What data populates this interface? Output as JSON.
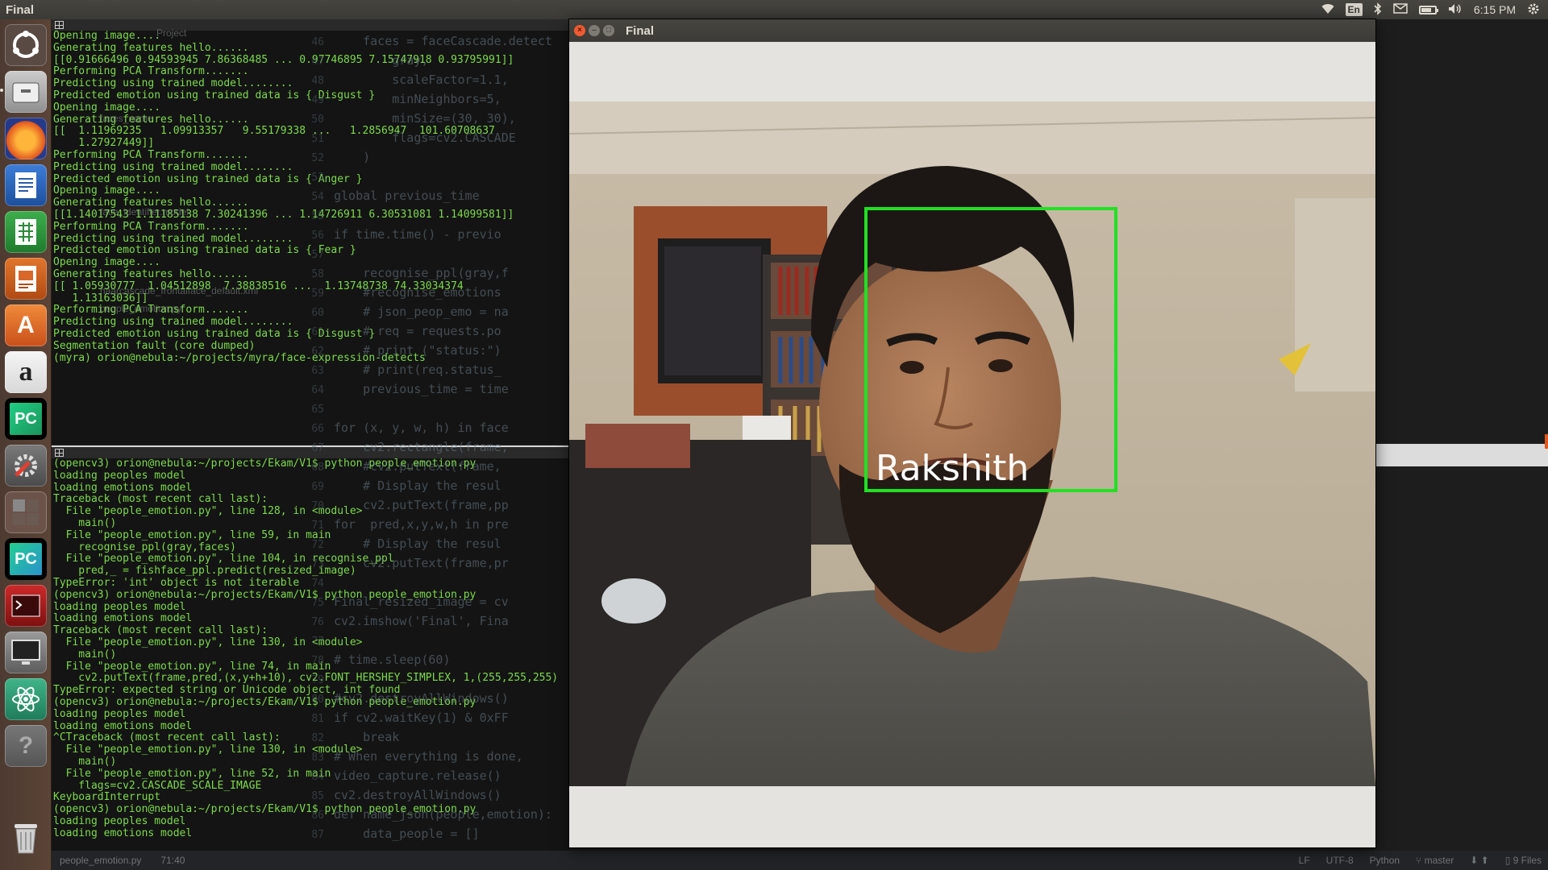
{
  "topbar": {
    "app_name": "Final",
    "input_lang": "En",
    "time": "6:15 PM"
  },
  "launcher": {
    "items": [
      {
        "name": "dash-home-icon"
      },
      {
        "name": "files-icon"
      },
      {
        "name": "firefox-icon"
      },
      {
        "name": "libreoffice-writer-icon"
      },
      {
        "name": "libreoffice-calc-icon"
      },
      {
        "name": "libreoffice-impress-icon"
      },
      {
        "name": "software-center-icon",
        "glyph": "A"
      },
      {
        "name": "amazon-icon",
        "glyph": "a"
      },
      {
        "name": "pycharm-icon",
        "glyph": "PC"
      },
      {
        "name": "system-settings-icon"
      },
      {
        "name": "workspace-switcher-icon"
      },
      {
        "name": "pycharm-icon-2",
        "glyph": "PC"
      },
      {
        "name": "terminal-red-icon"
      },
      {
        "name": "monitor-icon"
      },
      {
        "name": "atom-icon"
      },
      {
        "name": "help-icon",
        "glyph": "?"
      },
      {
        "name": "trash-icon"
      }
    ]
  },
  "terminal_top": {
    "lines": [
      "Opening image....",
      "Generating features hello......",
      "[[0.91666496 0.94593945 7.86368485 ... 0.97746895 7.15747918 0.93795991]]",
      "Performing PCA Transform.......",
      "Predicting using trained model........",
      "Predicted emotion using trained data is { Disgust }",
      "",
      "Opening image....",
      "Generating features hello......",
      "[[  1.11969235   1.09913357   9.55179338 ...   1.2856947  101.60708637",
      "    1.27927449]]",
      "Performing PCA Transform.......",
      "Predicting using trained model........",
      "Predicted emotion using trained data is { Anger }",
      "Opening image....",
      "Generating features hello......",
      "[[1.14017543 1.11185138 7.30241396 ... 1.14726911 6.30531081 1.14099581]]",
      "Performing PCA Transform.......",
      "Predicting using trained model........",
      "Predicted emotion using trained data is { Fear }",
      "",
      "Opening image....",
      "Generating features hello......",
      "[[ 1.05930777  1.04512898  7.38838516 ...  1.13748738 74.33034374",
      "   1.13163036]]",
      "Performing PCA Transform.......",
      "Predicting using trained model........",
      "Predicted emotion using trained data is { Disgust }",
      "",
      "Segmentation fault (core dumped)",
      "(myra) orion@nebula:~/projects/myra/face-expression-detects "
    ]
  },
  "terminal_bottom": {
    "lines": [
      "(opencv3) orion@nebula:~/projects/Ekam/V1$ python people_emotion.py",
      "loading peoples model",
      "loading emotions model",
      "Traceback (most recent call last):",
      "  File \"people_emotion.py\", line 128, in <module>",
      "    main()",
      "  File \"people_emotion.py\", line 59, in main",
      "    recognise_ppl(gray,faces)",
      "  File \"people_emotion.py\", line 104, in recognise_ppl",
      "    pred,_ = fishface_ppl.predict(resized_image)",
      "TypeError: 'int' object is not iterable",
      "(opencv3) orion@nebula:~/projects/Ekam/V1$ python people_emotion.py",
      "loading peoples model",
      "loading emotions model",
      "Traceback (most recent call last):",
      "  File \"people_emotion.py\", line 130, in <module>",
      "    main()",
      "  File \"people_emotion.py\", line 74, in main",
      "    cv2.putText(frame,pred,(x,y+h+10), cv2.FONT_HERSHEY_SIMPLEX, 1,(255,255,255)",
      "TypeError: expected string or Unicode object, int found",
      "(opencv3) orion@nebula:~/projects/Ekam/V1$ python people_emotion.py",
      "loading peoples model",
      "loading emotions model",
      "^CTraceback (most recent call last):",
      "  File \"people_emotion.py\", line 130, in <module>",
      "    main()",
      "  File \"people_emotion.py\", line 52, in main",
      "    flags=cv2.CASCADE_SCALE_IMAGE",
      "KeyboardInterrupt",
      "(opencv3) orion@nebula:~/projects/Ekam/V1$ python people_emotion.py",
      "loading peoples model",
      "loading emotions model"
    ]
  },
  "project_tree": {
    "items": [
      "Project",
      "faces_name",
      "face_identifier.model",
      "haarcascade_frontalface_default.xml",
      "people_emotion.py"
    ]
  },
  "editor": {
    "lines": [
      {
        "n": "46",
        "code": "    faces = faceCascade.detect"
      },
      {
        "n": "47",
        "code": "        gray,"
      },
      {
        "n": "48",
        "code": "        scaleFactor=1.1,"
      },
      {
        "n": "49",
        "code": "        minNeighbors=5,"
      },
      {
        "n": "50",
        "code": "        minSize=(30, 30),"
      },
      {
        "n": "51",
        "code": "        flags=cv2.CASCADE"
      },
      {
        "n": "52",
        "code": "    )"
      },
      {
        "n": "53",
        "code": ""
      },
      {
        "n": "54",
        "code": "global previous_time"
      },
      {
        "n": "55",
        "code": ""
      },
      {
        "n": "56",
        "code": "if time.time() - previo"
      },
      {
        "n": "57",
        "code": ""
      },
      {
        "n": "58",
        "code": "    recognise_ppl(gray,f"
      },
      {
        "n": "59",
        "code": "    #recognise_emotions"
      },
      {
        "n": "60",
        "code": "    # json_peop_emo = na"
      },
      {
        "n": "61",
        "code": "    # req = requests.po"
      },
      {
        "n": "62",
        "code": "    # print (\"status:\")"
      },
      {
        "n": "63",
        "code": "    # print(req.status_"
      },
      {
        "n": "64",
        "code": "    previous_time = time"
      },
      {
        "n": "65",
        "code": ""
      },
      {
        "n": "66",
        "code": "for (x, y, w, h) in face"
      },
      {
        "n": "67",
        "code": "    cv2.rectangle(frame,"
      },
      {
        "n": "68",
        "code": "    #cv2.putText(frame,"
      },
      {
        "n": "69",
        "code": "    # Display the resul"
      },
      {
        "n": "70",
        "code": "    cv2.putText(frame,pp"
      },
      {
        "n": "71",
        "code": "for  pred,x,y,w,h in pre"
      },
      {
        "n": "72",
        "code": "    # Display the resul"
      },
      {
        "n": "73",
        "code": "    cv2.putText(frame,pr"
      },
      {
        "n": "74",
        "code": ""
      },
      {
        "n": "75",
        "code": "Final_resized_image = cv"
      },
      {
        "n": "76",
        "code": "cv2.imshow('Final', Fina"
      },
      {
        "n": "77",
        "code": ""
      },
      {
        "n": "78",
        "code": "# time.sleep(60)"
      },
      {
        "n": "79",
        "code": ""
      },
      {
        "n": "80",
        "code": "#cv2.destroyAllWindows()"
      },
      {
        "n": "81",
        "code": "if cv2.waitKey(1) & 0xFF"
      },
      {
        "n": "82",
        "code": "    break"
      },
      {
        "n": "83",
        "code": "# When everything is done,"
      },
      {
        "n": "84",
        "code": "video_capture.release()"
      },
      {
        "n": "85",
        "code": "cv2.destroyAllWindows()"
      },
      {
        "n": "86",
        "code": "def name_json(people,emotion):"
      },
      {
        "n": "87",
        "code": "    data_people = []"
      }
    ]
  },
  "statusbar": {
    "file": "people_emotion.py",
    "position": "71:40",
    "line_sep": "LF",
    "encoding": "UTF-8",
    "language": "Python",
    "branch": "master",
    "files": "9 Files"
  },
  "window": {
    "title": "Final",
    "detected_name": "Rakshith"
  },
  "colors": {
    "terminal_text": "#7bdb4a",
    "detection_box": "#22e022",
    "titlebar": "#3c3b37"
  }
}
